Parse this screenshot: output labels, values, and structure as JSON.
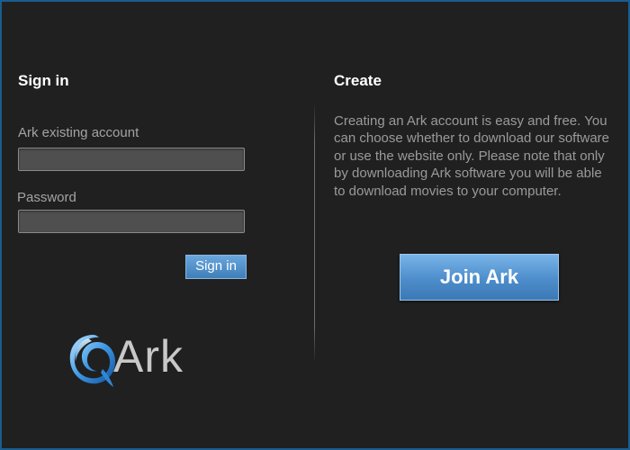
{
  "signin": {
    "heading": "Sign in",
    "account_label": "Ark existing account",
    "account_value": "",
    "password_label": "Password",
    "password_value": "",
    "button_label": "Sign in"
  },
  "create": {
    "heading": "Create",
    "description": "Creating an Ark account is easy and free. You can choose whether to download our software or use the website only. Please note that only by downloading Ark software you will be able to download movies to your computer.",
    "button_label": "Join Ark"
  },
  "logo": {
    "text": "Ark",
    "icon": "ark-swirl-logo-icon"
  },
  "colors": {
    "background": "#202020",
    "frame_border": "#1a5c8f",
    "accent_blue": "#4d8dcb",
    "heading": "#ffffff",
    "body_text": "#9a9a9a"
  }
}
